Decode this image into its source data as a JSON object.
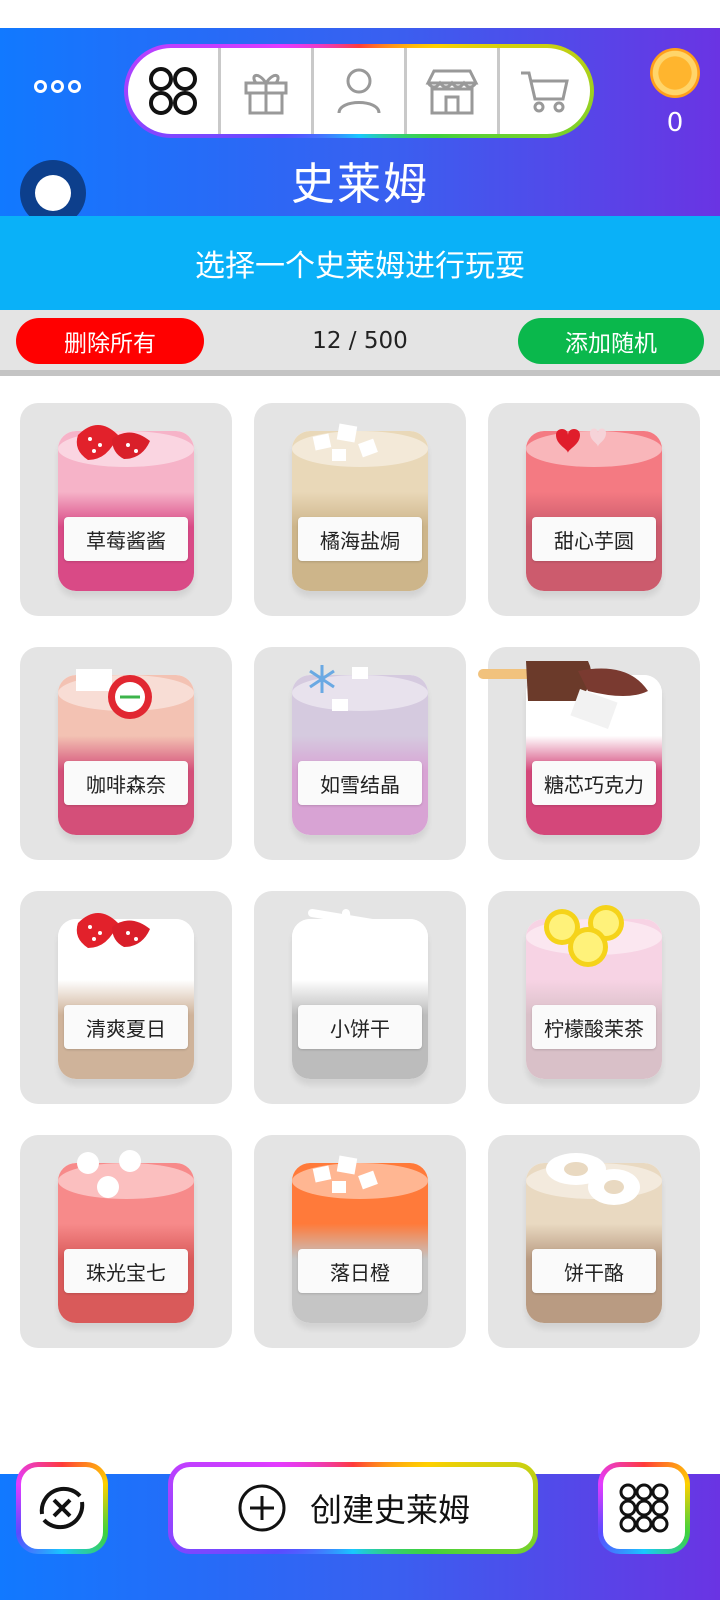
{
  "header": {
    "title": "史莱姆",
    "coin_count": "0",
    "nav": [
      {
        "icon": "grid-circles-icon"
      },
      {
        "icon": "gift-icon"
      },
      {
        "icon": "person-icon"
      },
      {
        "icon": "shop-icon"
      },
      {
        "icon": "cart-icon"
      }
    ]
  },
  "subheader": {
    "text": "选择一个史莱姆进行玩耍"
  },
  "toolbar": {
    "delete_all": "删除所有",
    "count": "12 / 500",
    "add_random": "添加随机"
  },
  "slimes": [
    {
      "name": "草莓酱酱",
      "top": "#f6b3c8",
      "bottom": "#d94a86",
      "topping": "strawberry"
    },
    {
      "name": "橘海盐焗",
      "top": "#e9d8b8",
      "bottom": "#cdb58a",
      "topping": "cubes"
    },
    {
      "name": "甜心芋圆",
      "top": "#f47a82",
      "bottom": "#cc5b6d",
      "topping": "hearts"
    },
    {
      "name": "咖啡森奈",
      "top": "#f3c2b3",
      "bottom": "#d44f79",
      "topping": "apple"
    },
    {
      "name": "如雪结晶",
      "top": "#d5cadf",
      "bottom": "#d8a3d4",
      "topping": "snowflake"
    },
    {
      "name": "糖芯巧克力",
      "top": "#ffffff",
      "bottom": "#d4477a",
      "topping": "icecream"
    },
    {
      "name": "清爽夏日",
      "top": "#ffffff",
      "bottom": "#cfb39a",
      "topping": "strawberry"
    },
    {
      "name": "小饼干",
      "top": "#ffffff",
      "bottom": "#bcbcbc",
      "topping": "bone"
    },
    {
      "name": "柠檬酸茉茶",
      "top": "#f7d3e4",
      "bottom": "#d9c0c8",
      "topping": "lemon"
    },
    {
      "name": "珠光宝七",
      "top": "#f78a8a",
      "bottom": "#d95a5a",
      "topping": "pearls"
    },
    {
      "name": "落日橙",
      "top": "#ff7a3a",
      "bottom": "#c5c5c5",
      "topping": "cubes"
    },
    {
      "name": "饼干酪",
      "top": "#e9d9c1",
      "bottom": "#b99b82",
      "topping": "donut"
    }
  ],
  "bottom": {
    "create_label": "创建史莱姆"
  }
}
